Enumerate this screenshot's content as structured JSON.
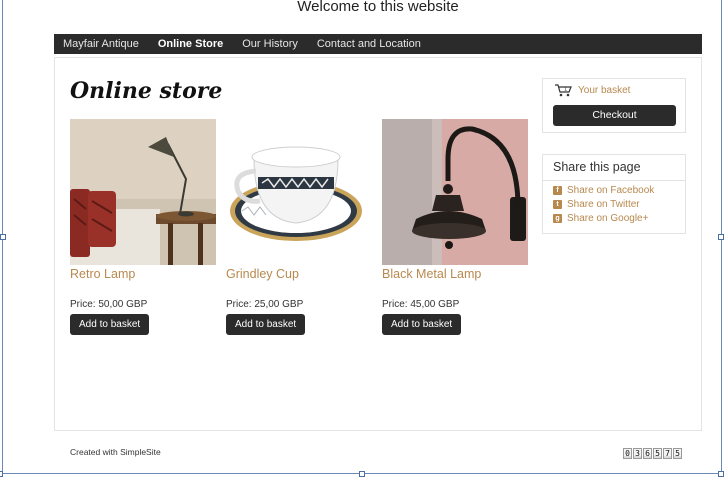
{
  "window": {
    "title": "Welcome to this website"
  },
  "nav": {
    "items": [
      {
        "label": "Mayfair Antique",
        "active": false
      },
      {
        "label": "Online Store",
        "active": true
      },
      {
        "label": "Our History",
        "active": false
      },
      {
        "label": "Contact and Location",
        "active": false
      }
    ]
  },
  "main": {
    "title": "Online store",
    "products": [
      {
        "name": "Retro Lamp",
        "price": "Price: 50,00 GBP",
        "button": "Add to basket"
      },
      {
        "name": "Grindley Cup",
        "price": "Price: 25,00 GBP",
        "button": "Add to basket"
      },
      {
        "name": "Black Metal Lamp",
        "price": "Price: 45,00 GBP",
        "button": "Add to basket"
      }
    ]
  },
  "sidebar": {
    "basket": {
      "label": "Your basket",
      "icon": "basket-icon",
      "checkout": "Checkout"
    },
    "share": {
      "title": "Share this page",
      "items": [
        {
          "label": "Share on Facebook",
          "icon": "facebook-icon"
        },
        {
          "label": "Share on Twitter",
          "icon": "twitter-icon"
        },
        {
          "label": "Share on Google+",
          "icon": "googleplus-icon"
        }
      ]
    }
  },
  "footer": {
    "credit": "Created with SimpleSite",
    "counter": [
      "0",
      "3",
      "6",
      "5",
      "7",
      "5"
    ]
  },
  "colors": {
    "accent": "#b8894f",
    "nav_bg": "#2b2b2b",
    "button_bg": "#2b2b2b"
  }
}
